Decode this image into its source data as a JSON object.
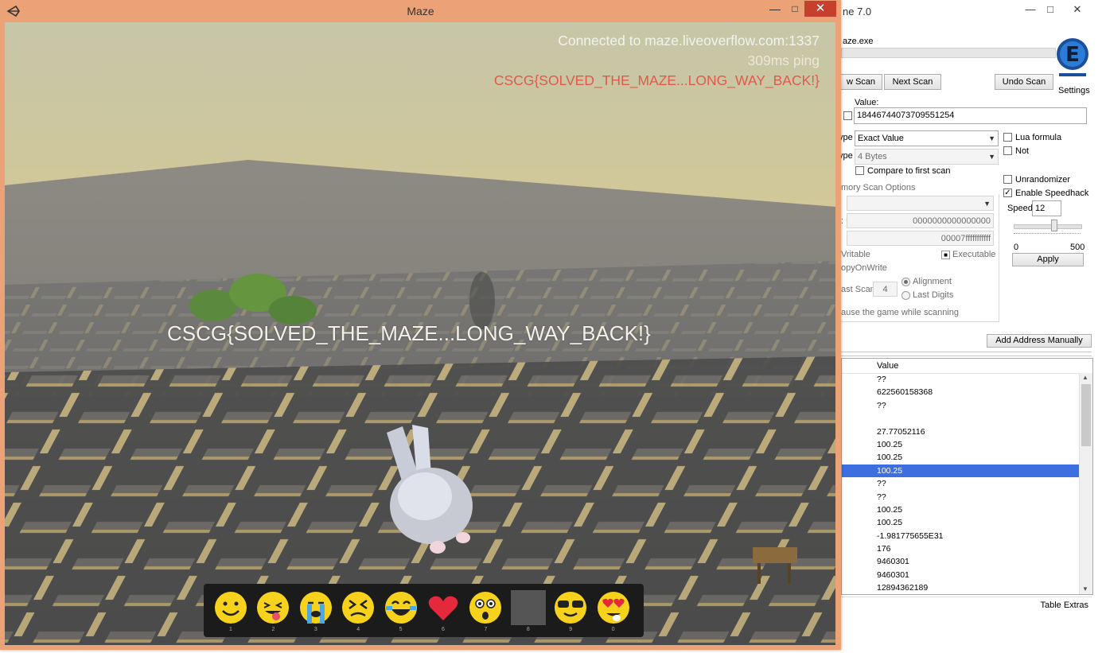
{
  "cheat_engine": {
    "title": "ne 7.0",
    "process": "aze.exe",
    "buttons": {
      "new_scan": "w Scan",
      "next_scan": "Next Scan",
      "undo_scan": "Undo Scan",
      "settings": "Settings",
      "add_address": "Add Address Manually",
      "apply": "Apply"
    },
    "value_label": "Value:",
    "value": "18446744073709551254",
    "scan_type_label": "ype",
    "scan_type": "Exact Value",
    "value_type_label": "ype",
    "value_type": "4 Bytes",
    "compare_first": "Compare to first scan",
    "lua_formula": "Lua formula",
    "not_label": "Not",
    "unrandomizer": "Unrandomizer",
    "enable_speedhack": "Enable Speedhack",
    "speed_label": "Speed",
    "speed_value": "12",
    "speed_min": "0",
    "speed_max": "500",
    "speed_fraction": 0.024,
    "memory_scan_options": "mory Scan Options",
    "start_label": ":",
    "start": "0000000000000000",
    "stop_label": "",
    "stop": "00007fffffffffff",
    "writable": "Vritable",
    "executable": "Executable",
    "copy_on_write": "opyOnWrite",
    "fast_scan": "ast Scan",
    "fast_scan_value": "4",
    "alignment": "Alignment",
    "last_digits": "Last Digits",
    "pause_game": "ause the game while scanning",
    "column_value": "Value",
    "rows": [
      "??",
      "622560158368",
      "??",
      "",
      "27.77052116",
      "100.25",
      "100.25",
      "100.25",
      "??",
      "??",
      "100.25",
      "100.25",
      "-1.981775655E31",
      "176",
      "9460301",
      "9460301",
      "12894362189"
    ],
    "selected_row": 7,
    "table_extras": "Table Extras"
  },
  "maze": {
    "title": "Maze",
    "hud": {
      "connected": "Connected to maze.liveoverflow.com:1337",
      "ping": "309ms ping",
      "flag": "CSCG{SOLVED_THE_MAZE...LONG_WAY_BACK!}"
    },
    "center_flag": "CSCG{SOLVED_THE_MAZE...LONG_WAY_BACK!}",
    "hotbar": [
      {
        "emoji": "smile",
        "key": "1"
      },
      {
        "emoji": "tongue",
        "key": "2"
      },
      {
        "emoji": "crying",
        "key": "3"
      },
      {
        "emoji": "tired",
        "key": "4"
      },
      {
        "emoji": "laughing",
        "key": "5"
      },
      {
        "emoji": "heart",
        "key": "6"
      },
      {
        "emoji": "surprised",
        "key": "7"
      },
      {
        "emoji": "empty",
        "key": "8"
      },
      {
        "emoji": "sunglasses",
        "key": "9"
      },
      {
        "emoji": "heart-eyes",
        "key": "0"
      }
    ]
  },
  "colors": {
    "close_red": "#c7402f",
    "flag_red": "#e05a4b",
    "selection_blue": "#3d6fe0",
    "window_frame": "#eaa276"
  }
}
